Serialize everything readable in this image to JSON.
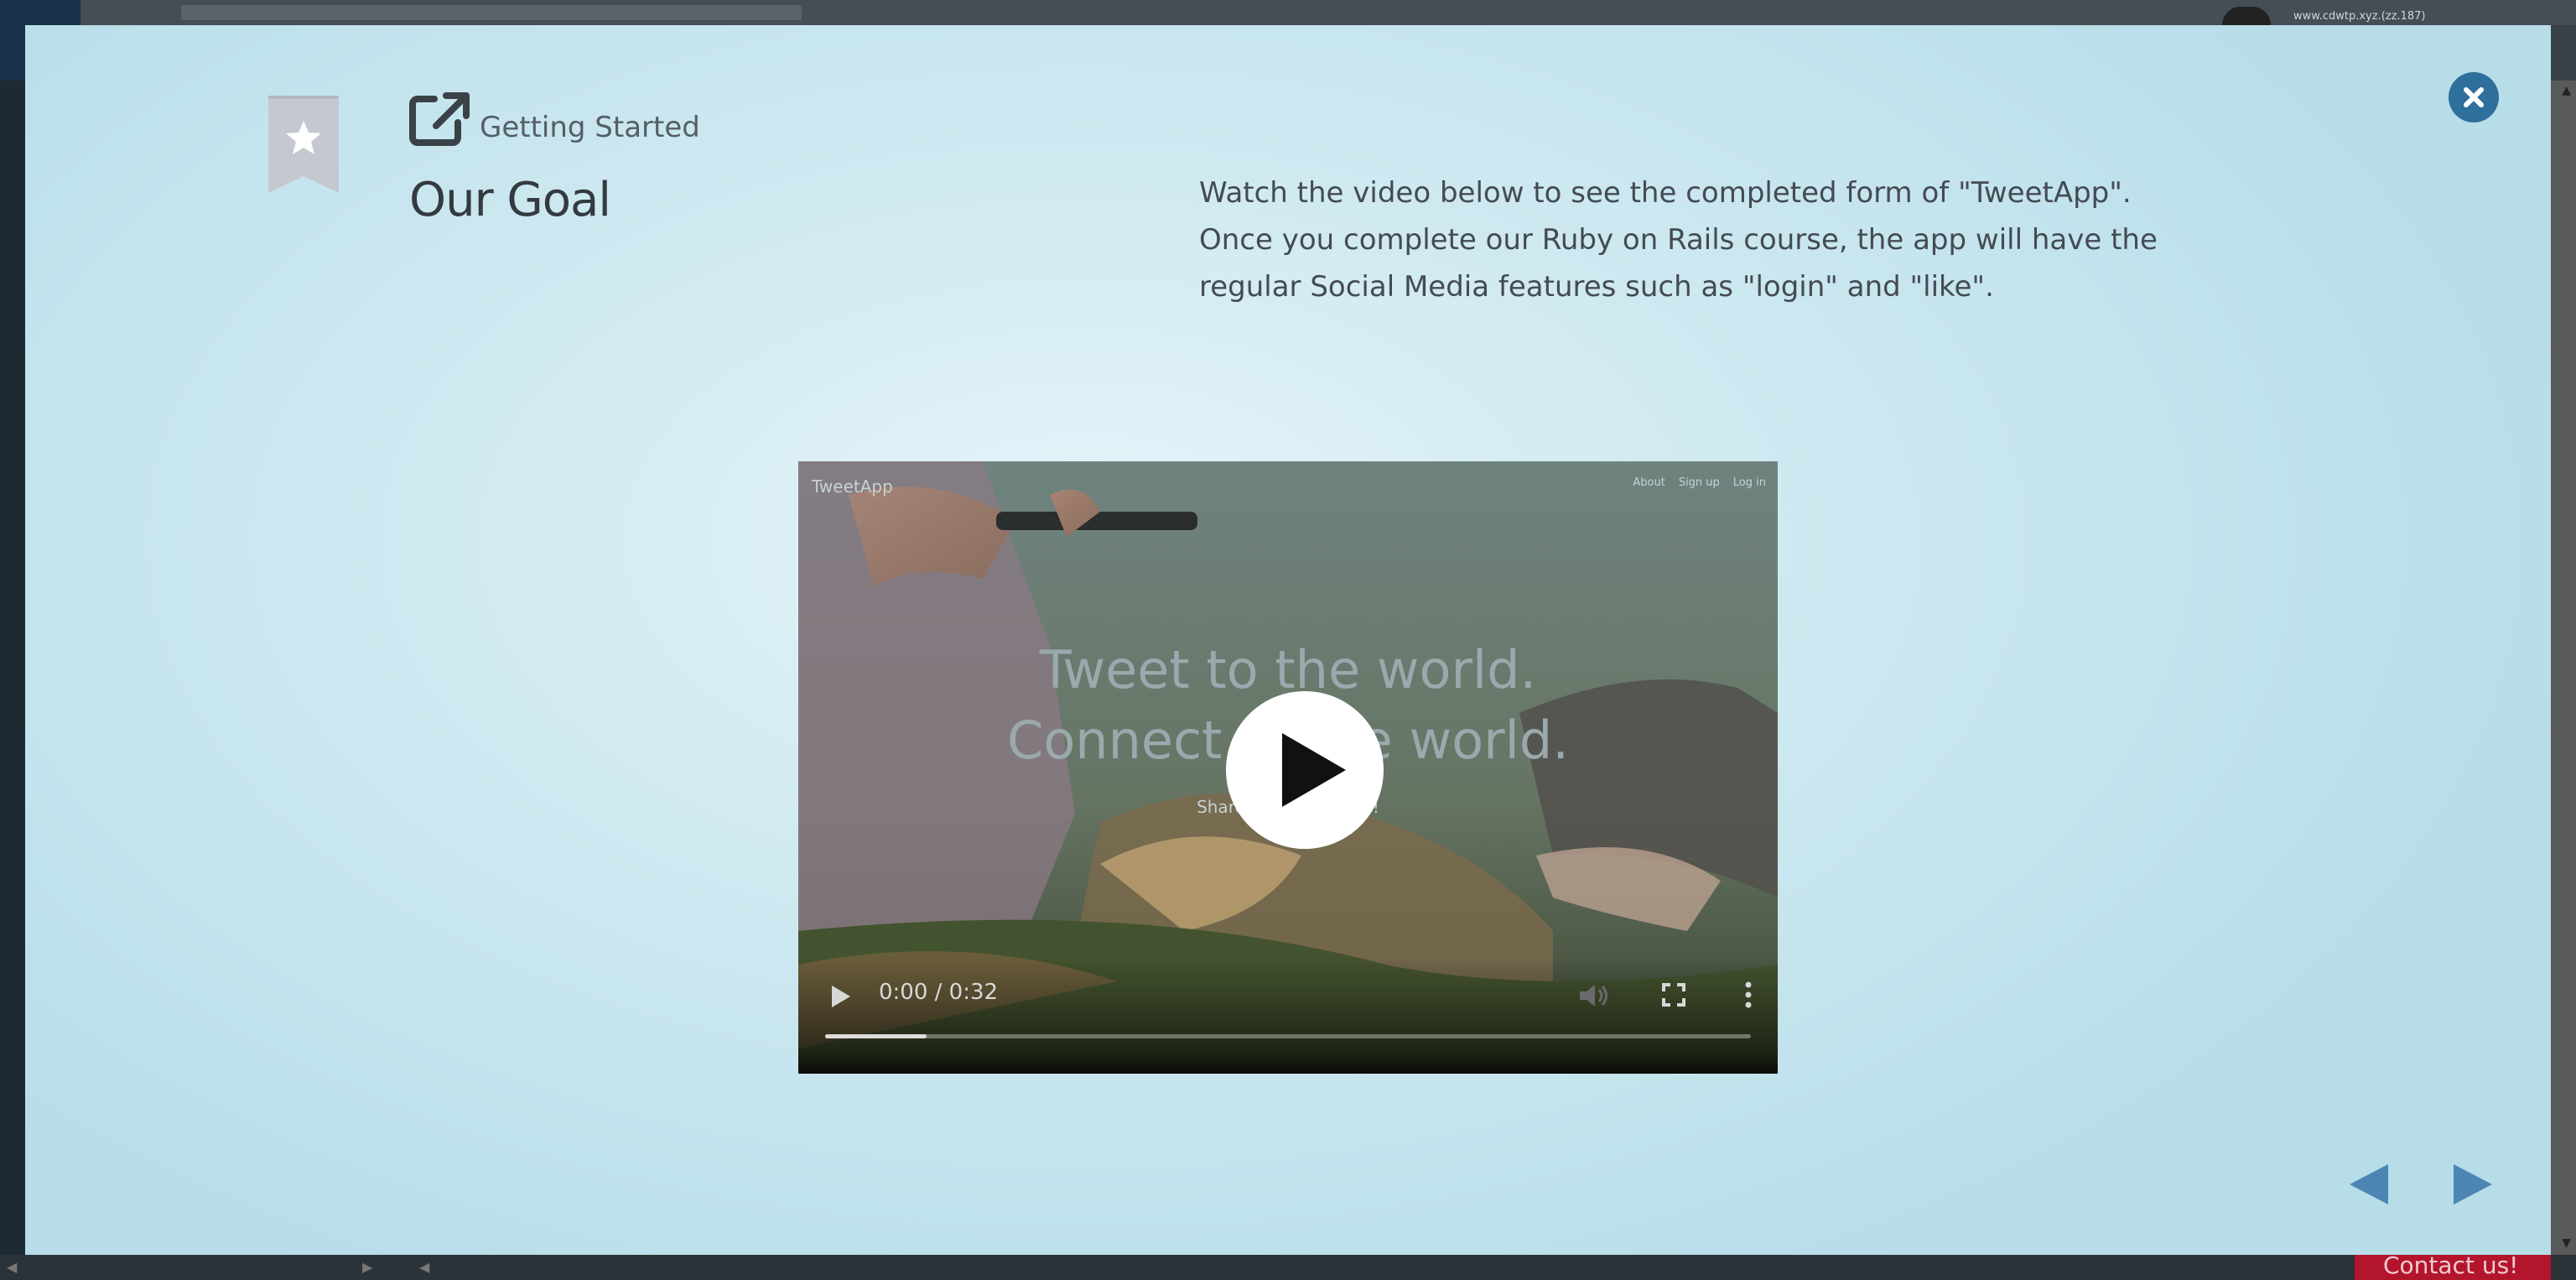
{
  "background_app": {
    "user_label": "www.cdwtp.xyz.(zz.187)",
    "contact_label": "Contact us!"
  },
  "modal": {
    "subtitle": "Getting Started",
    "title": "Our Goal",
    "description_lines": [
      "Watch the video below to see the completed form of \"TweetApp\".",
      "Once you complete our Ruby on Rails course, the app will have the",
      "regular Social Media features such as \"login\" and \"like\"."
    ],
    "icons": {
      "close": "close-icon",
      "bookmark": "bookmark-star-icon",
      "external": "external-link-icon",
      "prev": "triangle-left-icon",
      "next": "triangle-right-icon"
    }
  },
  "video": {
    "brand": "TweetApp",
    "nav": [
      "About",
      "Sign up",
      "Log in"
    ],
    "headline_1": "Tweet to the world.",
    "headline_2": "Connect to the world.",
    "tagline": "Share your moments!",
    "time": "0:00 / 0:32",
    "progress": 0.11
  },
  "colors": {
    "accent": "#2f6f9c",
    "nav_arrow": "#4b86b4",
    "bookmark": "#c4c8d0"
  }
}
